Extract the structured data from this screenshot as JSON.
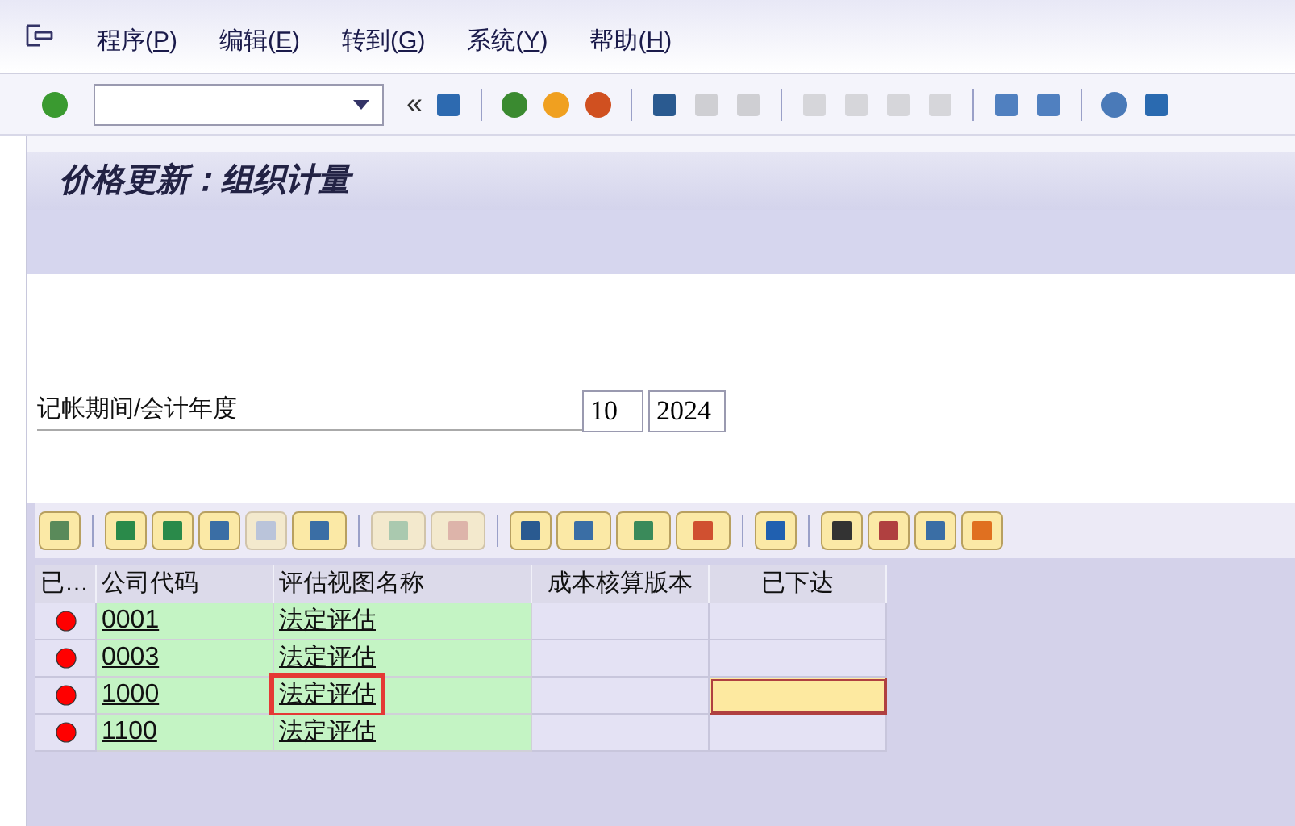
{
  "menu": [
    {
      "prefix": "程序(",
      "key": "P",
      "suffix": ")"
    },
    {
      "prefix": "编辑(",
      "key": "E",
      "suffix": ")"
    },
    {
      "prefix": "转到(",
      "key": "G",
      "suffix": ")"
    },
    {
      "prefix": "系统(",
      "key": "Y",
      "suffix": ")"
    },
    {
      "prefix": "帮助(",
      "key": "H",
      "suffix": ")"
    }
  ],
  "toolbar": {
    "back_glyph": "«"
  },
  "title": "价格更新：组织计量",
  "form": {
    "label": "记帐期间/会计年度",
    "period": "10",
    "year": "2024"
  },
  "grid": {
    "columns": [
      "已…",
      "公司代码",
      "评估视图名称",
      "成本核算版本",
      "已下达"
    ],
    "rows": [
      {
        "color": "#ff0000",
        "company": "0001",
        "view": "法定评估",
        "highlighted": false,
        "focused": false
      },
      {
        "color": "#ff0000",
        "company": "0003",
        "view": "法定评估",
        "highlighted": false,
        "focused": false
      },
      {
        "color": "#ff0000",
        "company": "1000",
        "view": "法定评估",
        "highlighted": true,
        "focused": true
      },
      {
        "color": "#ff0000",
        "company": "1100",
        "view": "法定评估",
        "highlighted": false,
        "focused": false
      }
    ]
  }
}
